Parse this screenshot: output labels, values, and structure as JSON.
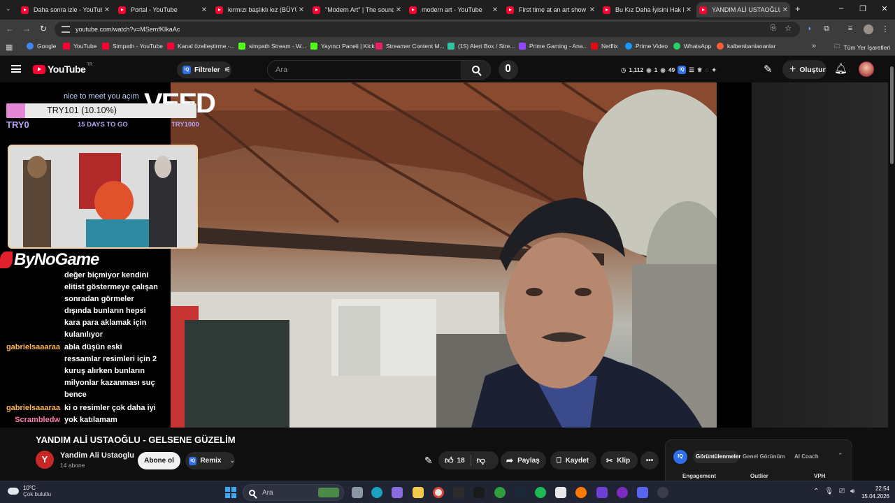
{
  "tabs": [
    {
      "title": "Daha sonra izle - YouTube",
      "active": false
    },
    {
      "title": "Portal - YouTube",
      "active": false
    },
    {
      "title": "kırmızı başlıklı kız (BÜYÜK",
      "active": false
    },
    {
      "title": "\"Modern Art\" | The sound",
      "active": false
    },
    {
      "title": "modern art - YouTube",
      "active": false
    },
    {
      "title": "First time at an art show -",
      "active": false
    },
    {
      "title": "Bu Kız Daha İyisini Hak Ed",
      "active": false
    },
    {
      "title": "YANDIM ALİ USTAOĞLU",
      "active": true
    }
  ],
  "address_bar": {
    "url": "youtube.com/watch?v=MSemfKIkaAc"
  },
  "bookmarks": [
    {
      "label": "Google",
      "color": "#4285f4"
    },
    {
      "label": "YouTube",
      "color": "#ff0033"
    },
    {
      "label": "Simpath - YouTube",
      "color": "#ff0033"
    },
    {
      "label": "Kanal özelleştirme -...",
      "color": "#ff0033"
    },
    {
      "label": "simpath Stream - W...",
      "color": "#53fc18"
    },
    {
      "label": "Yayıncı Paneli | Kick",
      "color": "#53fc18"
    },
    {
      "label": "Streamer Content M...",
      "color": "#e91e63"
    },
    {
      "label": "(15) Alert Box / Stre...",
      "color": "#31c3a2"
    },
    {
      "label": "Prime Gaming - Ana...",
      "color": "#9146ff"
    },
    {
      "label": "Netflix",
      "color": "#e50914"
    },
    {
      "label": "Prime Video",
      "color": "#1399ff"
    },
    {
      "label": "WhatsApp",
      "color": "#25d366"
    },
    {
      "label": "kalbenbanlananlar",
      "color": "#ff5a36"
    }
  ],
  "all_bookmarks_label": "Tüm Yer İşaretleri",
  "yt_header": {
    "logo_text": "YouTube",
    "logo_region": "TR",
    "filters_label": "Filtreler",
    "search_placeholder": "Ara",
    "stats": {
      "clock": "1,112",
      "views": "1",
      "eye": "49"
    },
    "create_label": "Oluştur"
  },
  "overlay": {
    "goal_header": "nice to meet you açım",
    "goal_label": "TRY101 (10.10%)",
    "goal_progress": 0.101,
    "goal_min": "TRY0",
    "goal_days": "15 DAYS TO GO",
    "goal_max": "TRY1000",
    "watermark": "VEED",
    "sponsor": "ByNoGame"
  },
  "chat": [
    {
      "user": "",
      "message": "değer biçmiyor kendini elitist göstermeye çalışan sonradan görmeler dışında bunların hepsi kara para aklamak için kulanılıyor"
    },
    {
      "user": "gabrielsaaaraa",
      "message": "abla düşün eski ressamlar resimleri için 2 kuruş alırken bunların milyonlar kazanması suç bence"
    },
    {
      "user": "gabrielsaaaraa",
      "message": "ki o resimler çok daha iyi"
    },
    {
      "user": "Scrambledw",
      "message": "yok katılamam"
    }
  ],
  "video": {
    "title": "YANDIM ALİ USTAOĞLU - GELSENE GÜZELİM",
    "channel_initial": "Y",
    "channel_name": "Yandim Ali Ustaoglu",
    "subscribers": "14 abone",
    "subscribe_label": "Abone ol",
    "remix_label": "Remix",
    "likes": "18",
    "share_label": "Paylaş",
    "save_label": "Kaydet",
    "clip_label": "Klip"
  },
  "stats_panel": {
    "tabs": [
      "Görüntülenmeler",
      "Genel Görünüm",
      "AI Coach"
    ],
    "headers": [
      "Engagement",
      "Outlier",
      "VPH"
    ]
  },
  "taskbar": {
    "temperature": "10°C",
    "weather": "Çok bulutlu",
    "search_placeholder": "Ara",
    "time": "22:54",
    "date": "15.04.2026"
  }
}
